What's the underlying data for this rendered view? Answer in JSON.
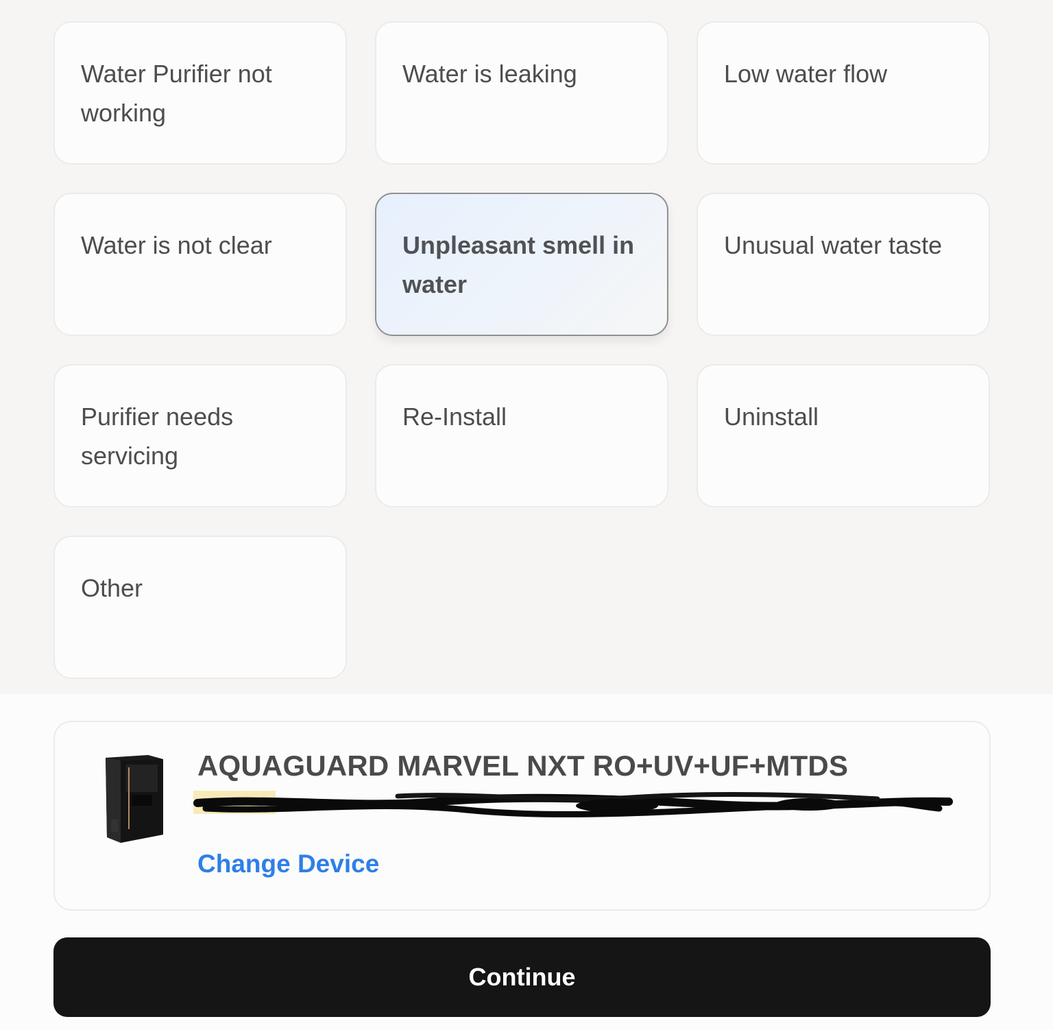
{
  "issues": [
    {
      "label": "Water Purifier not working",
      "selected": false
    },
    {
      "label": "Water is leaking",
      "selected": false
    },
    {
      "label": "Low water flow",
      "selected": false
    },
    {
      "label": "Water is not clear",
      "selected": false
    },
    {
      "label": "Unpleasant smell in water",
      "selected": true
    },
    {
      "label": "Unusual water taste",
      "selected": false
    },
    {
      "label": "Purifier needs servicing",
      "selected": false
    },
    {
      "label": "Re-Install",
      "selected": false
    },
    {
      "label": "Uninstall",
      "selected": false
    },
    {
      "label": "Other",
      "selected": false
    }
  ],
  "device": {
    "name": "AQUAGUARD MARVEL NXT RO+UV+UF+MTDS",
    "image_icon": "water-purifier-icon",
    "change_label": "Change Device"
  },
  "continue_label": "Continue",
  "colors": {
    "page_bg": "#f6f5f4",
    "card_bg": "#fcfcfc",
    "selected_bg": "#e6f0fc",
    "selected_border": "#8f9092",
    "link": "#2f7fe6",
    "button_bg": "#151515"
  }
}
